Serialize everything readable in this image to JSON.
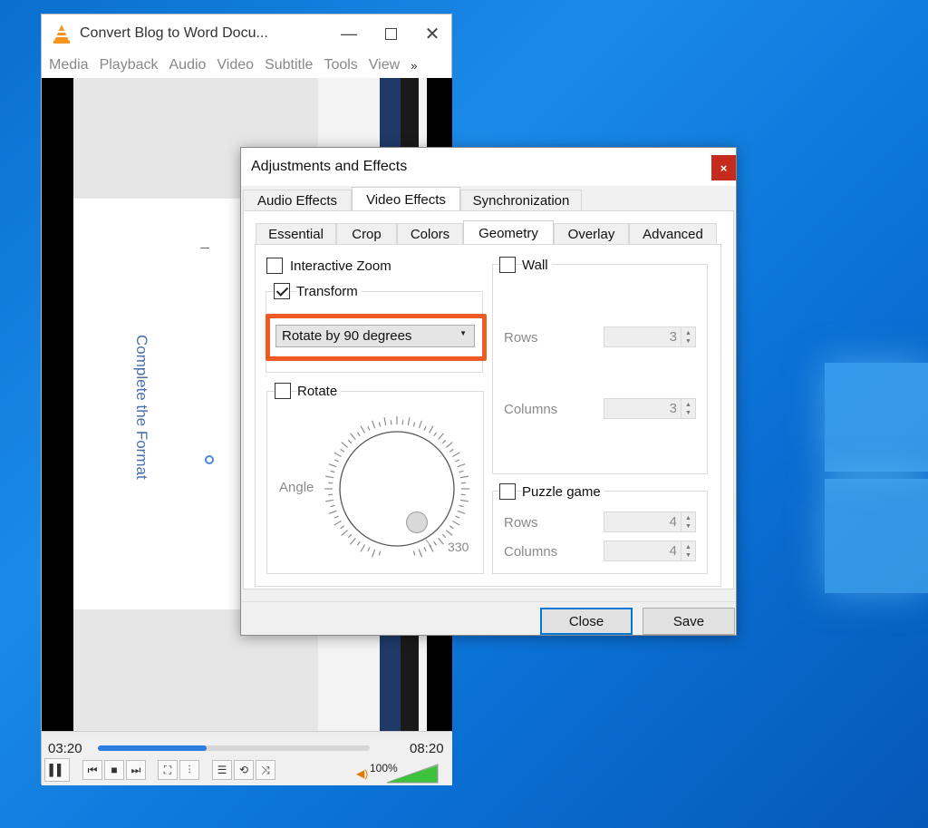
{
  "vlc": {
    "title": "Convert Blog to Word Docu...",
    "menu": [
      "Media",
      "Playback",
      "Audio",
      "Video",
      "Subtitle",
      "Tools",
      "View"
    ],
    "menu_more": "»",
    "video_text": "Complete the Format",
    "time_elapsed": "03:20",
    "time_total": "08:20",
    "volume": "100%",
    "progress_fraction": 0.4,
    "volume_fraction": 1.0
  },
  "dialog": {
    "title": "Adjustments and Effects",
    "close_glyph": "×",
    "main_tabs": [
      "Audio Effects",
      "Video Effects",
      "Synchronization"
    ],
    "sub_tabs": [
      "Essential",
      "Crop",
      "Colors",
      "Geometry",
      "Overlay",
      "Advanced"
    ],
    "interactive_zoom": "Interactive Zoom",
    "transform": "Transform",
    "transform_select": "Rotate by 90 degrees",
    "rotate": "Rotate",
    "angle_label": "Angle",
    "angle_value": "330",
    "wall": "Wall",
    "rows_label": "Rows",
    "rows_value": "3",
    "columns_label": "Columns",
    "columns_value": "3",
    "puzzle": "Puzzle game",
    "puzzle_rows_label": "Rows",
    "puzzle_rows_value": "4",
    "puzzle_columns_label": "Columns",
    "puzzle_columns_value": "4",
    "close_button": "Close",
    "save_button": "Save"
  },
  "colors": {
    "highlight": "#f15a22",
    "close_red": "#c42b1c",
    "accent_blue": "#0078d7",
    "vlc_orange": "#f7941d"
  }
}
